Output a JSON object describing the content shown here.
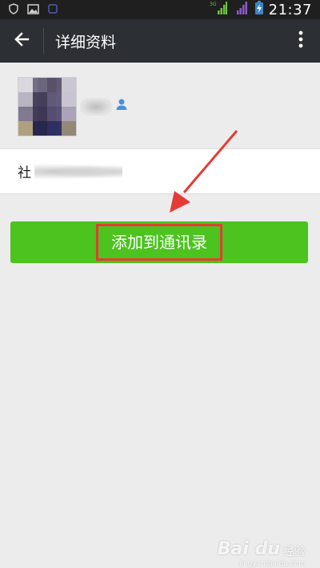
{
  "status_bar": {
    "time": "21:37",
    "network_label": "3G"
  },
  "app_bar": {
    "title": "详细资料"
  },
  "profile": {
    "nickname": "",
    "info_label": "社"
  },
  "actions": {
    "add_to_contacts_label": "添加到通讯录"
  },
  "watermark": {
    "brand": "Bai du",
    "brand_suffix": "经验",
    "url": "jingyan.baidu.com"
  },
  "colors": {
    "status_bar_bg": "#1f1f1f",
    "app_bar_bg": "#2c2f33",
    "page_bg": "#ececec",
    "button_green": "#4cc31e",
    "annotation_red": "#e53b35",
    "signal_green": "#6ec43a",
    "signal_purple": "#8a5cc7",
    "gender_blue": "#4a90d9"
  },
  "icons": {
    "back": "arrow-left-icon",
    "more": "more-vertical-icon",
    "gender": "male-person-icon"
  }
}
